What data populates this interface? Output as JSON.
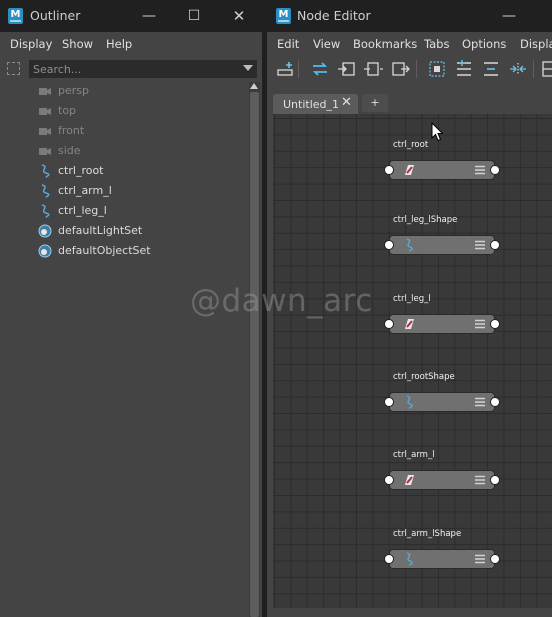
{
  "outliner": {
    "title": "Outliner",
    "menu": [
      "Display",
      "Show",
      "Help"
    ],
    "search_placeholder": "Search...",
    "items": [
      {
        "label": "persp",
        "icon": "camera-icon",
        "dim": true
      },
      {
        "label": "top",
        "icon": "camera-icon",
        "dim": true
      },
      {
        "label": "front",
        "icon": "camera-icon",
        "dim": true
      },
      {
        "label": "side",
        "icon": "camera-icon",
        "dim": true
      },
      {
        "label": "ctrl_root",
        "icon": "curve-icon",
        "dim": false
      },
      {
        "label": "ctrl_arm_l",
        "icon": "curve-icon",
        "dim": false
      },
      {
        "label": "ctrl_leg_l",
        "icon": "curve-icon",
        "dim": false
      },
      {
        "label": "defaultLightSet",
        "icon": "set-icon",
        "dim": false
      },
      {
        "label": "defaultObjectSet",
        "icon": "set-icon",
        "dim": false
      }
    ]
  },
  "node_editor": {
    "title": "Node Editor",
    "menu": [
      "Edit",
      "View",
      "Bookmarks",
      "Tabs",
      "Options",
      "Display"
    ],
    "tab_label": "Untitled_1",
    "tab_close": "✕",
    "add_tab": "+",
    "nodes": [
      {
        "name": "ctrl_root",
        "icon": "transform-icon"
      },
      {
        "name": "ctrl_leg_lShape",
        "icon": "curve-shape-icon"
      },
      {
        "name": "ctrl_leg_l",
        "icon": "transform-icon"
      },
      {
        "name": "ctrl_rootShape",
        "icon": "curve-shape-icon"
      },
      {
        "name": "ctrl_arm_l",
        "icon": "transform-icon"
      },
      {
        "name": "ctrl_arm_lShape",
        "icon": "curve-shape-icon"
      }
    ]
  },
  "app_icon_letter": "M",
  "window_controls": {
    "minimize": "—",
    "maximize": "☐",
    "close": "✕"
  },
  "watermark": "@dawn_arc",
  "colors": {
    "accent": "#2b8ec4",
    "node_body": "#707070",
    "graph_bg": "#393939",
    "panel_bg": "#444444"
  }
}
